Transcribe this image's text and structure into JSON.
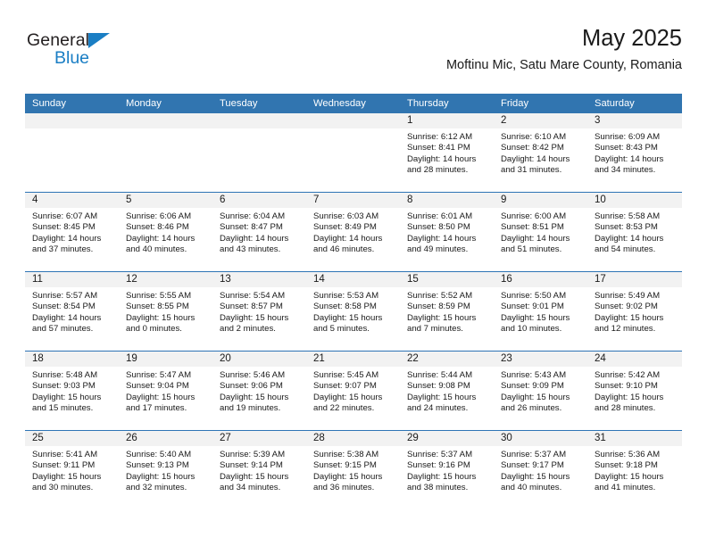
{
  "brand": {
    "name_part1": "General",
    "name_part2": "Blue",
    "triangle_icon": "triangle-icon"
  },
  "header": {
    "title": "May 2025",
    "subtitle": "Moftinu Mic, Satu Mare County, Romania"
  },
  "colors": {
    "header_blue": "#3175b0",
    "separator_blue": "#2e74b5",
    "daynum_gray": "#f2f2f2",
    "logo_blue": "#1a7ec4"
  },
  "calendar": {
    "weekday_headers": [
      "Sunday",
      "Monday",
      "Tuesday",
      "Wednesday",
      "Thursday",
      "Friday",
      "Saturday"
    ],
    "labels": {
      "sunrise": "Sunrise:",
      "sunset": "Sunset:",
      "daylight": "Daylight:"
    },
    "weeks": [
      [
        {
          "day": "",
          "empty": true
        },
        {
          "day": "",
          "empty": true
        },
        {
          "day": "",
          "empty": true
        },
        {
          "day": "",
          "empty": true
        },
        {
          "day": "1",
          "sunrise": "Sunrise: 6:12 AM",
          "sunset": "Sunset: 8:41 PM",
          "daylight_l1": "Daylight: 14 hours",
          "daylight_l2": "and 28 minutes."
        },
        {
          "day": "2",
          "sunrise": "Sunrise: 6:10 AM",
          "sunset": "Sunset: 8:42 PM",
          "daylight_l1": "Daylight: 14 hours",
          "daylight_l2": "and 31 minutes."
        },
        {
          "day": "3",
          "sunrise": "Sunrise: 6:09 AM",
          "sunset": "Sunset: 8:43 PM",
          "daylight_l1": "Daylight: 14 hours",
          "daylight_l2": "and 34 minutes."
        }
      ],
      [
        {
          "day": "4",
          "sunrise": "Sunrise: 6:07 AM",
          "sunset": "Sunset: 8:45 PM",
          "daylight_l1": "Daylight: 14 hours",
          "daylight_l2": "and 37 minutes."
        },
        {
          "day": "5",
          "sunrise": "Sunrise: 6:06 AM",
          "sunset": "Sunset: 8:46 PM",
          "daylight_l1": "Daylight: 14 hours",
          "daylight_l2": "and 40 minutes."
        },
        {
          "day": "6",
          "sunrise": "Sunrise: 6:04 AM",
          "sunset": "Sunset: 8:47 PM",
          "daylight_l1": "Daylight: 14 hours",
          "daylight_l2": "and 43 minutes."
        },
        {
          "day": "7",
          "sunrise": "Sunrise: 6:03 AM",
          "sunset": "Sunset: 8:49 PM",
          "daylight_l1": "Daylight: 14 hours",
          "daylight_l2": "and 46 minutes."
        },
        {
          "day": "8",
          "sunrise": "Sunrise: 6:01 AM",
          "sunset": "Sunset: 8:50 PM",
          "daylight_l1": "Daylight: 14 hours",
          "daylight_l2": "and 49 minutes."
        },
        {
          "day": "9",
          "sunrise": "Sunrise: 6:00 AM",
          "sunset": "Sunset: 8:51 PM",
          "daylight_l1": "Daylight: 14 hours",
          "daylight_l2": "and 51 minutes."
        },
        {
          "day": "10",
          "sunrise": "Sunrise: 5:58 AM",
          "sunset": "Sunset: 8:53 PM",
          "daylight_l1": "Daylight: 14 hours",
          "daylight_l2": "and 54 minutes."
        }
      ],
      [
        {
          "day": "11",
          "sunrise": "Sunrise: 5:57 AM",
          "sunset": "Sunset: 8:54 PM",
          "daylight_l1": "Daylight: 14 hours",
          "daylight_l2": "and 57 minutes."
        },
        {
          "day": "12",
          "sunrise": "Sunrise: 5:55 AM",
          "sunset": "Sunset: 8:55 PM",
          "daylight_l1": "Daylight: 15 hours",
          "daylight_l2": "and 0 minutes."
        },
        {
          "day": "13",
          "sunrise": "Sunrise: 5:54 AM",
          "sunset": "Sunset: 8:57 PM",
          "daylight_l1": "Daylight: 15 hours",
          "daylight_l2": "and 2 minutes."
        },
        {
          "day": "14",
          "sunrise": "Sunrise: 5:53 AM",
          "sunset": "Sunset: 8:58 PM",
          "daylight_l1": "Daylight: 15 hours",
          "daylight_l2": "and 5 minutes."
        },
        {
          "day": "15",
          "sunrise": "Sunrise: 5:52 AM",
          "sunset": "Sunset: 8:59 PM",
          "daylight_l1": "Daylight: 15 hours",
          "daylight_l2": "and 7 minutes."
        },
        {
          "day": "16",
          "sunrise": "Sunrise: 5:50 AM",
          "sunset": "Sunset: 9:01 PM",
          "daylight_l1": "Daylight: 15 hours",
          "daylight_l2": "and 10 minutes."
        },
        {
          "day": "17",
          "sunrise": "Sunrise: 5:49 AM",
          "sunset": "Sunset: 9:02 PM",
          "daylight_l1": "Daylight: 15 hours",
          "daylight_l2": "and 12 minutes."
        }
      ],
      [
        {
          "day": "18",
          "sunrise": "Sunrise: 5:48 AM",
          "sunset": "Sunset: 9:03 PM",
          "daylight_l1": "Daylight: 15 hours",
          "daylight_l2": "and 15 minutes."
        },
        {
          "day": "19",
          "sunrise": "Sunrise: 5:47 AM",
          "sunset": "Sunset: 9:04 PM",
          "daylight_l1": "Daylight: 15 hours",
          "daylight_l2": "and 17 minutes."
        },
        {
          "day": "20",
          "sunrise": "Sunrise: 5:46 AM",
          "sunset": "Sunset: 9:06 PM",
          "daylight_l1": "Daylight: 15 hours",
          "daylight_l2": "and 19 minutes."
        },
        {
          "day": "21",
          "sunrise": "Sunrise: 5:45 AM",
          "sunset": "Sunset: 9:07 PM",
          "daylight_l1": "Daylight: 15 hours",
          "daylight_l2": "and 22 minutes."
        },
        {
          "day": "22",
          "sunrise": "Sunrise: 5:44 AM",
          "sunset": "Sunset: 9:08 PM",
          "daylight_l1": "Daylight: 15 hours",
          "daylight_l2": "and 24 minutes."
        },
        {
          "day": "23",
          "sunrise": "Sunrise: 5:43 AM",
          "sunset": "Sunset: 9:09 PM",
          "daylight_l1": "Daylight: 15 hours",
          "daylight_l2": "and 26 minutes."
        },
        {
          "day": "24",
          "sunrise": "Sunrise: 5:42 AM",
          "sunset": "Sunset: 9:10 PM",
          "daylight_l1": "Daylight: 15 hours",
          "daylight_l2": "and 28 minutes."
        }
      ],
      [
        {
          "day": "25",
          "sunrise": "Sunrise: 5:41 AM",
          "sunset": "Sunset: 9:11 PM",
          "daylight_l1": "Daylight: 15 hours",
          "daylight_l2": "and 30 minutes."
        },
        {
          "day": "26",
          "sunrise": "Sunrise: 5:40 AM",
          "sunset": "Sunset: 9:13 PM",
          "daylight_l1": "Daylight: 15 hours",
          "daylight_l2": "and 32 minutes."
        },
        {
          "day": "27",
          "sunrise": "Sunrise: 5:39 AM",
          "sunset": "Sunset: 9:14 PM",
          "daylight_l1": "Daylight: 15 hours",
          "daylight_l2": "and 34 minutes."
        },
        {
          "day": "28",
          "sunrise": "Sunrise: 5:38 AM",
          "sunset": "Sunset: 9:15 PM",
          "daylight_l1": "Daylight: 15 hours",
          "daylight_l2": "and 36 minutes."
        },
        {
          "day": "29",
          "sunrise": "Sunrise: 5:37 AM",
          "sunset": "Sunset: 9:16 PM",
          "daylight_l1": "Daylight: 15 hours",
          "daylight_l2": "and 38 minutes."
        },
        {
          "day": "30",
          "sunrise": "Sunrise: 5:37 AM",
          "sunset": "Sunset: 9:17 PM",
          "daylight_l1": "Daylight: 15 hours",
          "daylight_l2": "and 40 minutes."
        },
        {
          "day": "31",
          "sunrise": "Sunrise: 5:36 AM",
          "sunset": "Sunset: 9:18 PM",
          "daylight_l1": "Daylight: 15 hours",
          "daylight_l2": "and 41 minutes."
        }
      ]
    ]
  }
}
